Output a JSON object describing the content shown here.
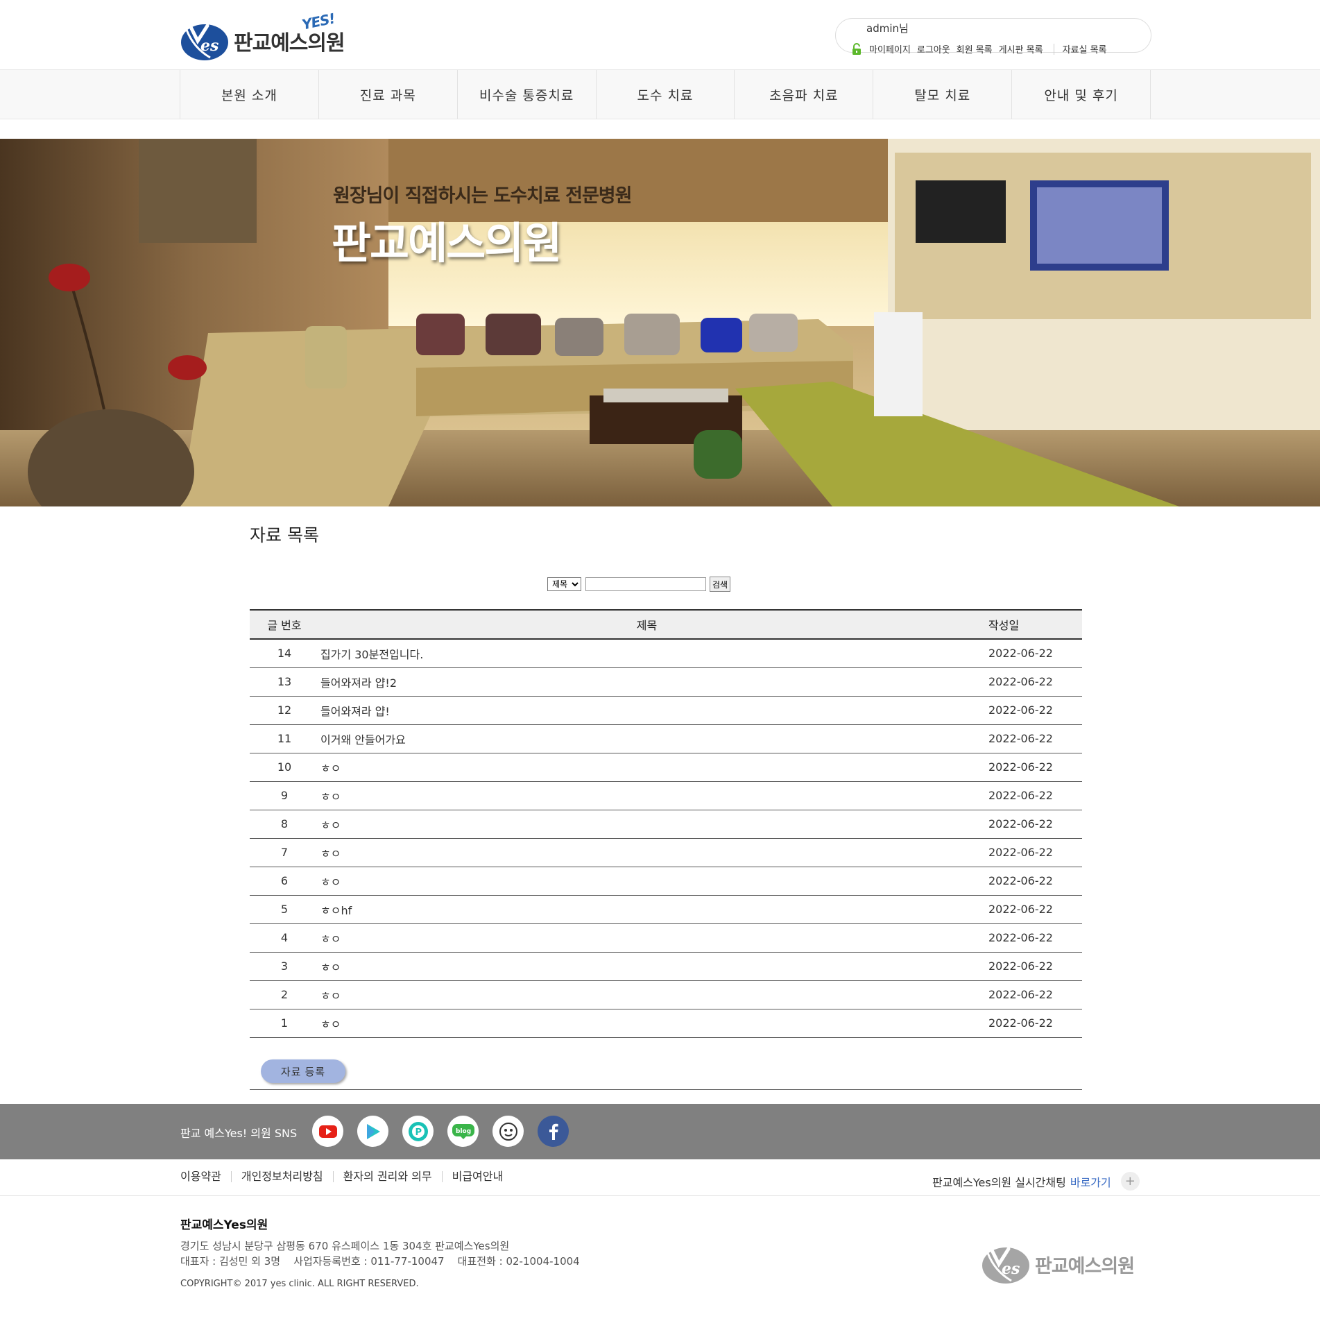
{
  "header": {
    "logo_text": "판교예스의원",
    "logo_badge": "YES!",
    "logo_mark": "es",
    "user_name": "admin님",
    "user_links": [
      "마이페이지",
      "로그아웃",
      "회원 목록",
      "게시판 목록"
    ],
    "user_link_extra": "자료실 목록"
  },
  "nav": {
    "items": [
      "본원 소개",
      "진료 과목",
      "비수술 통증치료",
      "도수 치료",
      "초음파 치료",
      "탈모 치료",
      "안내 및 후기"
    ]
  },
  "hero": {
    "subtitle": "원장님이 직접하시는 도수치료 전문병원",
    "title": "판교예스의원"
  },
  "main": {
    "page_title": "자료 목록",
    "search": {
      "field_option": "제목",
      "input_value": "",
      "button_label": "검색"
    },
    "table": {
      "headers": {
        "num": "글 번호",
        "subject": "제목",
        "date": "작성일"
      },
      "rows": [
        {
          "num": "14",
          "subject": "집가기 30분전입니다.",
          "date": "2022-06-22"
        },
        {
          "num": "13",
          "subject": "들어와져라 얍!2",
          "date": "2022-06-22"
        },
        {
          "num": "12",
          "subject": "들어와져라 얍!",
          "date": "2022-06-22"
        },
        {
          "num": "11",
          "subject": "이거왜 안들어가요",
          "date": "2022-06-22"
        },
        {
          "num": "10",
          "subject": "ㅎㅇ",
          "date": "2022-06-22"
        },
        {
          "num": "9",
          "subject": "ㅎㅇ",
          "date": "2022-06-22"
        },
        {
          "num": "8",
          "subject": "ㅎㅇ",
          "date": "2022-06-22"
        },
        {
          "num": "7",
          "subject": "ㅎㅇ",
          "date": "2022-06-22"
        },
        {
          "num": "6",
          "subject": "ㅎㅇ",
          "date": "2022-06-22"
        },
        {
          "num": "5",
          "subject": "ㅎㅇhf",
          "date": "2022-06-22"
        },
        {
          "num": "4",
          "subject": "ㅎㅇ",
          "date": "2022-06-22"
        },
        {
          "num": "3",
          "subject": "ㅎㅇ",
          "date": "2022-06-22"
        },
        {
          "num": "2",
          "subject": "ㅎㅇ",
          "date": "2022-06-22"
        },
        {
          "num": "1",
          "subject": "ㅎㅇ",
          "date": "2022-06-22"
        }
      ]
    },
    "register_button": "자료 등록"
  },
  "footer": {
    "sns_label": "판교 예스Yes! 의원 SNS",
    "sns_icons": [
      "youtube-icon",
      "play-icon",
      "post-icon",
      "blog-icon",
      "cafe-icon",
      "facebook-icon"
    ],
    "links": [
      "이용약관",
      "개인정보처리방침",
      "환자의 권리와 의무",
      "비급여안내"
    ],
    "chat_text": "판교예스Yes의원 실시간채팅",
    "chat_link": "바로가기",
    "company": "판교예스Yes의원",
    "address": "경기도 성남시 분당구 삼평동 670 유스페이스 1동 304호 판교예스Yes의원",
    "info": "대표자 : 김성민 외 3명    사업자등록번호 : 011-77-10047    대표전화 : 02-1004-1004",
    "copyright": "COPYRIGHT© 2017 yes clinic. ALL RIGHT RESERVED.",
    "logo_text": "판교예스의원"
  },
  "colors": {
    "logo_blue": "#1d4f9c",
    "register_button": "#a2b4e0",
    "sns_bar": "#808080",
    "facebook": "#3b5998",
    "chat_link": "#3b6cc4"
  }
}
